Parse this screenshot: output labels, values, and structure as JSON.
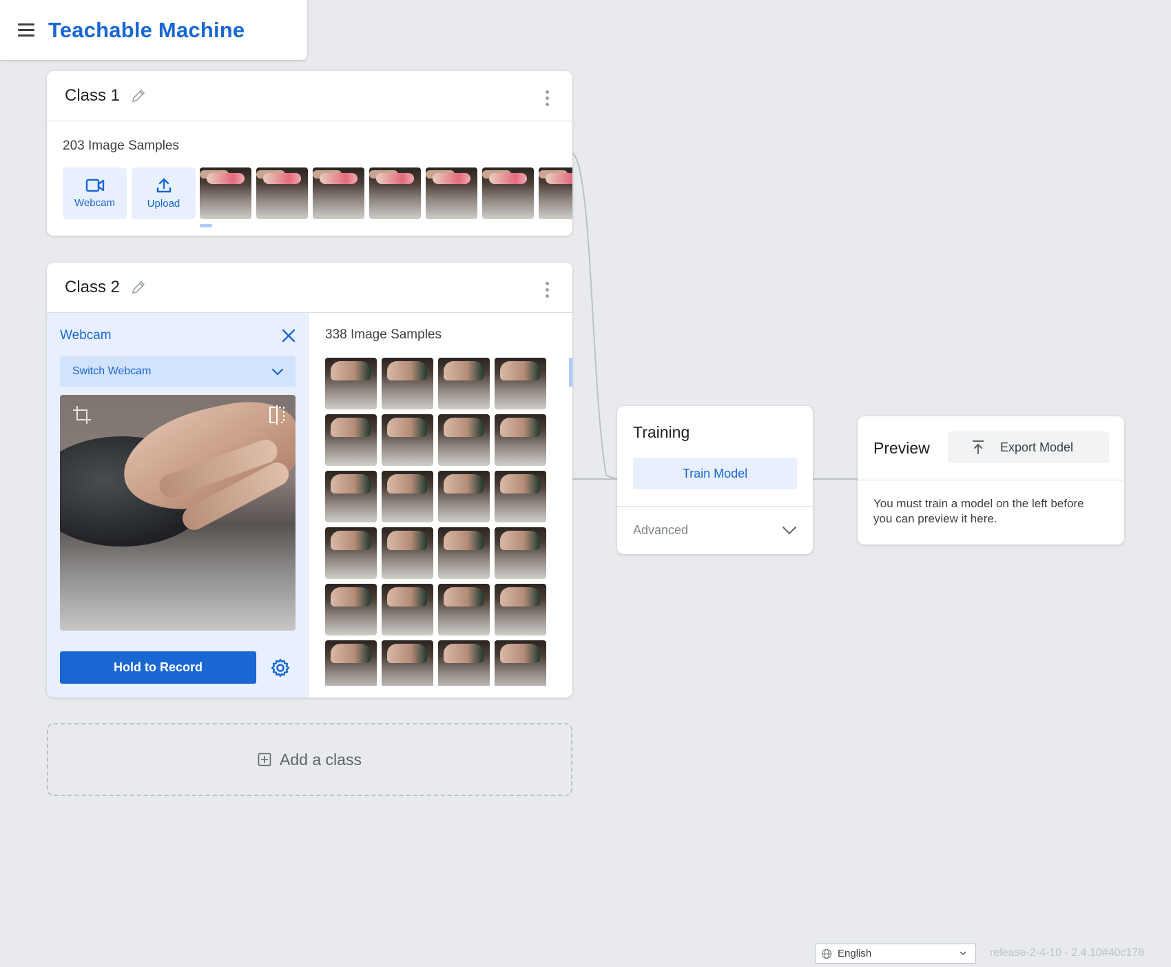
{
  "app": {
    "title": "Teachable Machine"
  },
  "class1": {
    "name": "Class 1",
    "samples_label": "203 Image Samples",
    "webcam_label": "Webcam",
    "upload_label": "Upload"
  },
  "class2": {
    "name": "Class 2",
    "webcam_title": "Webcam",
    "switch_webcam": "Switch Webcam",
    "record_label": "Hold to Record",
    "samples_label": "338 Image Samples"
  },
  "add_class": {
    "label": "Add a class"
  },
  "training": {
    "title": "Training",
    "train_label": "Train Model",
    "advanced_label": "Advanced"
  },
  "preview": {
    "title": "Preview",
    "export_label": "Export Model",
    "message": "You must train a model on the left before you can preview it here."
  },
  "footer": {
    "language": "English",
    "release": "release-2-4-10 - 2.4.10#40c178"
  },
  "colors": {
    "accent": "#1967d2",
    "accent_light": "#e8f0fe",
    "background": "#e8eaed"
  }
}
